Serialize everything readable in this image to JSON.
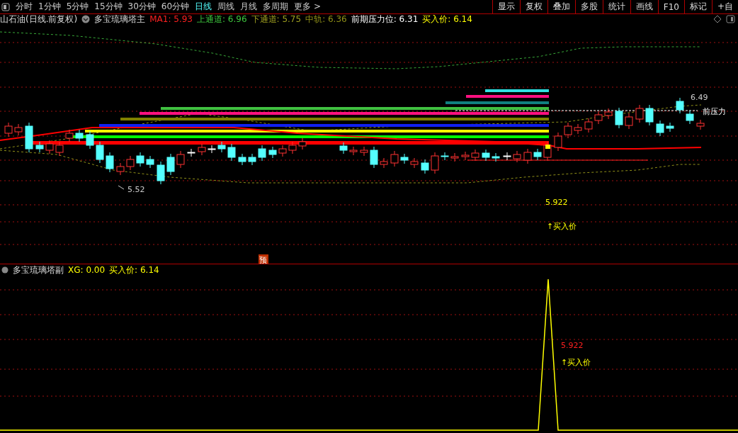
{
  "toolbar": {
    "periods": [
      {
        "label": "分时",
        "selected": false
      },
      {
        "label": "1分钟",
        "selected": false
      },
      {
        "label": "5分钟",
        "selected": false
      },
      {
        "label": "15分钟",
        "selected": false
      },
      {
        "label": "30分钟",
        "selected": false
      },
      {
        "label": "60分钟",
        "selected": false
      },
      {
        "label": "日线",
        "selected": true
      },
      {
        "label": "周线",
        "selected": false
      },
      {
        "label": "月线",
        "selected": false
      },
      {
        "label": "多周期",
        "selected": false
      },
      {
        "label": "更多 >",
        "selected": false
      }
    ],
    "buttons": [
      "显示",
      "复权",
      "叠加",
      "多股",
      "统计",
      "画线",
      "F10",
      "标记",
      "+自"
    ]
  },
  "main_chart": {
    "title": "山石油(日线.前复权)",
    "indicator": "多宝琉璃塔主",
    "values": [
      {
        "label": "MA1: 5.93",
        "color": "#ff2020"
      },
      {
        "label": "上通道: 6.96",
        "color": "#3ec83e"
      },
      {
        "label": "下通道: 5.75",
        "color": "#a0a020"
      },
      {
        "label": "中轨: 6.36",
        "color": "#909018"
      },
      {
        "label": "前期压力位: 6.31",
        "color": "#ffffff"
      },
      {
        "label": "买入价: 6.14",
        "color": "#ffff00"
      }
    ],
    "low_label": "5.52",
    "high_label": "6.49",
    "pressure_label": "前压力",
    "buy_value": "5.922",
    "buy_label": "↑买入价",
    "marker": "预"
  },
  "sub_chart": {
    "indicator": "多宝琉璃塔副",
    "values": [
      {
        "label": "XG: 0.00",
        "color": "#ffff00"
      },
      {
        "label": "买入价: 6.14",
        "color": "#ffff00"
      }
    ],
    "buy_value": "5.922",
    "buy_label": "↑买入价"
  }
}
